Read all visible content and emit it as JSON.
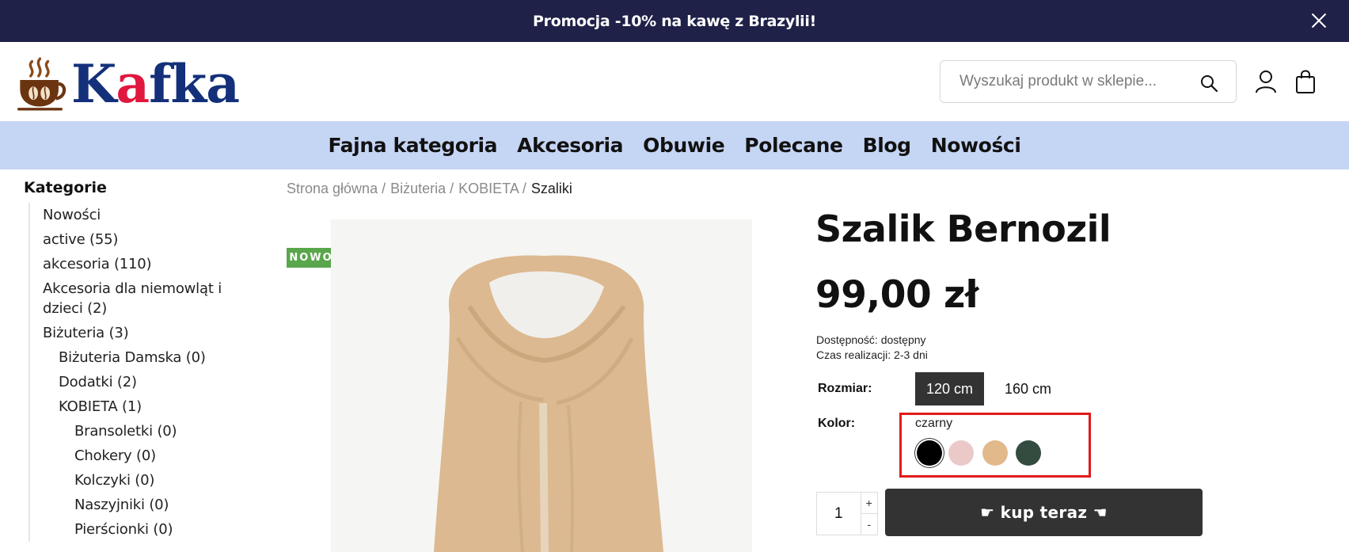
{
  "promo": {
    "text": "Promocja -10% na kawę z Brazylii!"
  },
  "header": {
    "logo_text_pre": "K",
    "logo_text_accent": "a",
    "logo_text_post": "fka",
    "search_placeholder": "Wyszukaj produkt w sklepie..."
  },
  "nav": {
    "items": [
      {
        "label": "Fajna kategoria"
      },
      {
        "label": "Akcesoria"
      },
      {
        "label": "Obuwie"
      },
      {
        "label": "Polecane"
      },
      {
        "label": "Blog"
      },
      {
        "label": "Nowości"
      }
    ]
  },
  "sidebar": {
    "title": "Kategorie",
    "items": [
      {
        "label": "Nowości",
        "level": 1
      },
      {
        "label": "active (55)",
        "level": 1
      },
      {
        "label": "akcesoria (110)",
        "level": 1
      },
      {
        "label": "Akcesoria dla niemowląt i dzieci (2)",
        "level": 1
      },
      {
        "label": "Biżuteria (3)",
        "level": 1
      },
      {
        "label": "Biżuteria Damska (0)",
        "level": 2
      },
      {
        "label": "Dodatki (2)",
        "level": 2
      },
      {
        "label": "KOBIETA (1)",
        "level": 2
      },
      {
        "label": "Bransoletki (0)",
        "level": 3
      },
      {
        "label": "Chokery (0)",
        "level": 3
      },
      {
        "label": "Kolczyki (0)",
        "level": 3
      },
      {
        "label": "Naszyjniki (0)",
        "level": 3
      },
      {
        "label": "Pierścionki (0)",
        "level": 3
      }
    ]
  },
  "breadcrumb": {
    "items": [
      "Strona główna",
      "Biżuteria",
      "KOBIETA"
    ],
    "current": "Szaliki"
  },
  "product": {
    "badge": "NOWOŚĆ",
    "title": "Szalik Bernozil",
    "price": "99,00 zł",
    "availability": "Dostępność: dostępny",
    "lead_time": "Czas realizacji: 2-3 dni",
    "size_label": "Rozmiar:",
    "sizes": [
      "120 cm",
      "160 cm"
    ],
    "selected_size": "120 cm",
    "color_label": "Kolor:",
    "selected_color": "czarny",
    "colors": [
      {
        "name": "czarny",
        "hex": "#000000"
      },
      {
        "name": "różowy",
        "hex": "#ecc9c9"
      },
      {
        "name": "beżowy",
        "hex": "#e2b98b"
      },
      {
        "name": "zielony",
        "hex": "#334c3f"
      }
    ],
    "quantity": "1",
    "qty_plus": "+",
    "qty_minus": "-",
    "buy_label": "☛ kup teraz ☚"
  }
}
